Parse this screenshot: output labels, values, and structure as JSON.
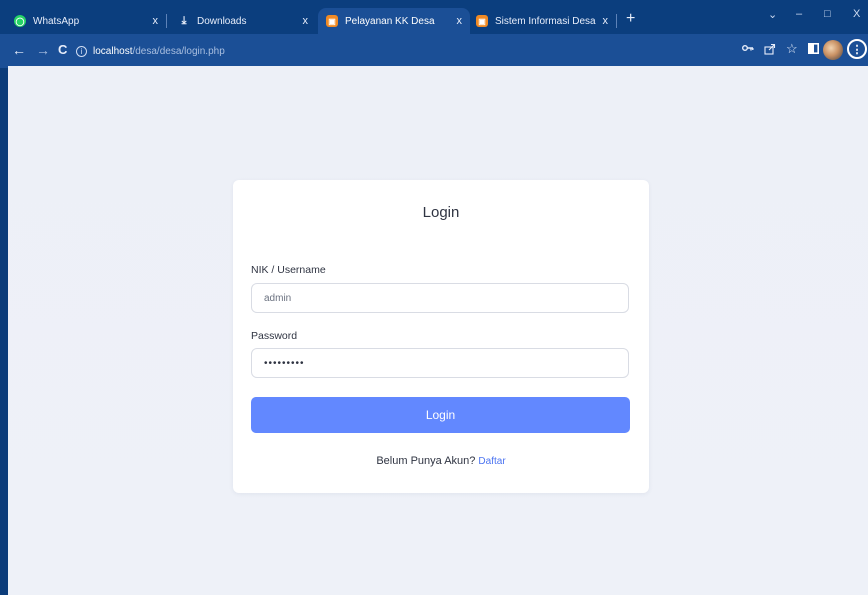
{
  "browser": {
    "tabs": [
      {
        "title": "WhatsApp",
        "icon": "whatsapp-icon",
        "active": false
      },
      {
        "title": "Downloads",
        "icon": "download-icon",
        "active": false
      },
      {
        "title": "Pelayanan KK Desa",
        "icon": "site-favicon",
        "active": true
      },
      {
        "title": "Sistem Informasi Desa",
        "icon": "site-favicon",
        "active": false
      }
    ],
    "close_glyph": "x",
    "new_tab_glyph": "+",
    "window_controls": {
      "dropdown": "⌄",
      "minimize": "–",
      "maximize": "□",
      "close": "X"
    },
    "nav": {
      "back": "←",
      "forward": "→",
      "reload": "C"
    },
    "url": {
      "info_glyph": "i",
      "host": "localhost",
      "path": "/desa/desa/login.php"
    },
    "toolbar_icons": [
      "key-icon",
      "share-icon",
      "star-icon",
      "sidepanel-icon",
      "profile-avatar",
      "menu-icon"
    ],
    "menu_glyph": "⋮"
  },
  "login": {
    "title": "Login",
    "username_label": "NIK / Username",
    "username_value": "admin",
    "password_label": "Password",
    "password_value": "•••••••••",
    "submit_label": "Login",
    "register_prompt": "Belum Punya Akun?",
    "register_link": "Daftar"
  },
  "colors": {
    "chrome_dark": "#0b3e7e",
    "chrome": "#1b4f96",
    "page_bg": "#eef1f8",
    "button": "#6288ff",
    "link": "#4c74f0"
  }
}
